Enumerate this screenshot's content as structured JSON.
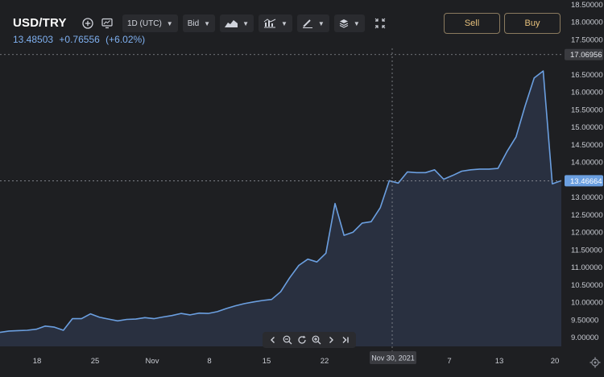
{
  "header": {
    "symbol": "USD/TRY",
    "last_price": "13.48503",
    "change": "+0.76556",
    "change_pct": "(+6.02%)"
  },
  "toolbar": {
    "add_icon": "plus-circle-icon",
    "screenshot_icon": "chart-monitor-icon",
    "interval_label": "1D (UTC)",
    "price_type_label": "Bid",
    "chart_type_icon": "area-chart-icon",
    "indicators_icon": "indicators-icon",
    "drawing_icon": "pencil-icon",
    "layers_icon": "layers-icon",
    "fullscreen_icon": "fullscreen-icon"
  },
  "trade": {
    "sell_label": "Sell",
    "buy_label": "Buy"
  },
  "navigation": {
    "icons": [
      "chevron-left-icon",
      "zoom-out-icon",
      "reset-icon",
      "zoom-in-icon",
      "chevron-right-icon",
      "scroll-to-end-icon"
    ]
  },
  "chart_data": {
    "type": "area",
    "x_labels": [
      "18",
      "25",
      "Nov",
      "8",
      "15",
      "22",
      "Nov 30, 2021",
      "7",
      "13",
      "20"
    ],
    "y_ticks": [
      "18.50000",
      "18.00000",
      "17.50000",
      "17.00000",
      "16.50000",
      "16.00000",
      "15.50000",
      "15.00000",
      "14.50000",
      "14.00000",
      "13.50000",
      "13.00000",
      "12.50000",
      "12.00000",
      "11.50000",
      "11.00000",
      "10.50000",
      "10.00000",
      "9.50000",
      "9.00000"
    ],
    "ylim": [
      8.8,
      18.5
    ],
    "crosshair_price": "17.06956",
    "crosshair_date": "Nov 30, 2021",
    "last_price_label": "13.46664",
    "grid": false,
    "colors": {
      "line": "#6b9fe0",
      "fill": "#2b3445",
      "crosshair_label": "#3a3b40",
      "last_price_label": "#6b9fe0"
    },
    "series": [
      {
        "values": [
          9.14,
          9.18,
          9.19,
          9.2,
          9.23,
          9.32,
          9.29,
          9.2,
          9.53,
          9.53,
          9.67,
          9.57,
          9.52,
          9.47,
          9.51,
          9.52,
          9.56,
          9.53,
          9.58,
          9.62,
          9.68,
          9.64,
          9.69,
          9.68,
          9.73,
          9.82,
          9.9,
          9.96,
          10.01,
          10.05,
          10.08,
          10.3,
          10.7,
          11.05,
          11.23,
          11.15,
          11.4,
          12.82,
          11.91,
          12.0,
          12.26,
          12.3,
          12.7,
          13.47,
          13.4,
          13.72,
          13.7,
          13.7,
          13.78,
          13.51,
          13.62,
          13.74,
          13.78,
          13.8,
          13.8,
          13.82,
          14.3,
          14.72,
          15.6,
          16.4,
          16.6,
          13.38,
          13.47
        ]
      }
    ]
  }
}
